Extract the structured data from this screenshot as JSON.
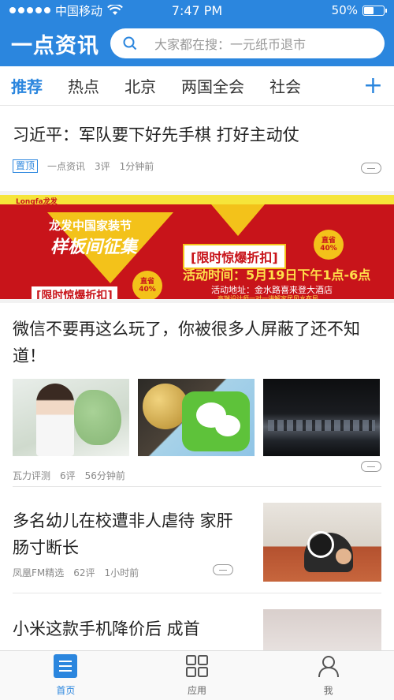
{
  "status_bar": {
    "carrier": "中国移动",
    "time": "7:47 PM",
    "battery": "50%",
    "battery_level": 0.5
  },
  "header": {
    "logo": "一点资讯",
    "search_placeholder": "大家都在搜：一元纸币退市"
  },
  "channels": {
    "tabs": [
      "推荐",
      "热点",
      "北京",
      "两国全会",
      "社会"
    ],
    "active_index": 0,
    "add_label": "+"
  },
  "feed": [
    {
      "title": "习近平：军队要下好先手棋 打好主动仗",
      "tag": "置顶",
      "source": "一点资讯",
      "comments": "3评",
      "time": "1分钟前"
    },
    {
      "title": "微信不要再这么玩了，你被很多人屏蔽了还不知道！",
      "source": "瓦力评测",
      "comments": "6评",
      "time": "56分钟前"
    },
    {
      "title": "多名幼儿在校遭非人虐待 家肝肠寸断长",
      "source": "凤凰FM精选",
      "comments": "62评",
      "time": "1小时前"
    },
    {
      "title": "小米这款手机降价后  成首"
    }
  ],
  "ad_banner": {
    "brand": "Longfa龙发",
    "title": "龙发中国家装节",
    "slogan": "样板间征集",
    "left_box": "[限时惊爆折扣]",
    "right_box": "[限时惊爆折扣]",
    "event_time": "活动时间：5月19日下午1点-6点",
    "event_location": "活动地址：金水路喜来登大酒店",
    "footer": "高端设计师一对一讲解家居风水布局",
    "discount": "直省 40%"
  },
  "bottom_nav": {
    "items": [
      "首页",
      "应用",
      "我"
    ],
    "active_index": 0
  },
  "colors": {
    "accent": "#2b86de",
    "banner_red": "#c8141a",
    "banner_yellow": "#f3c21a"
  }
}
